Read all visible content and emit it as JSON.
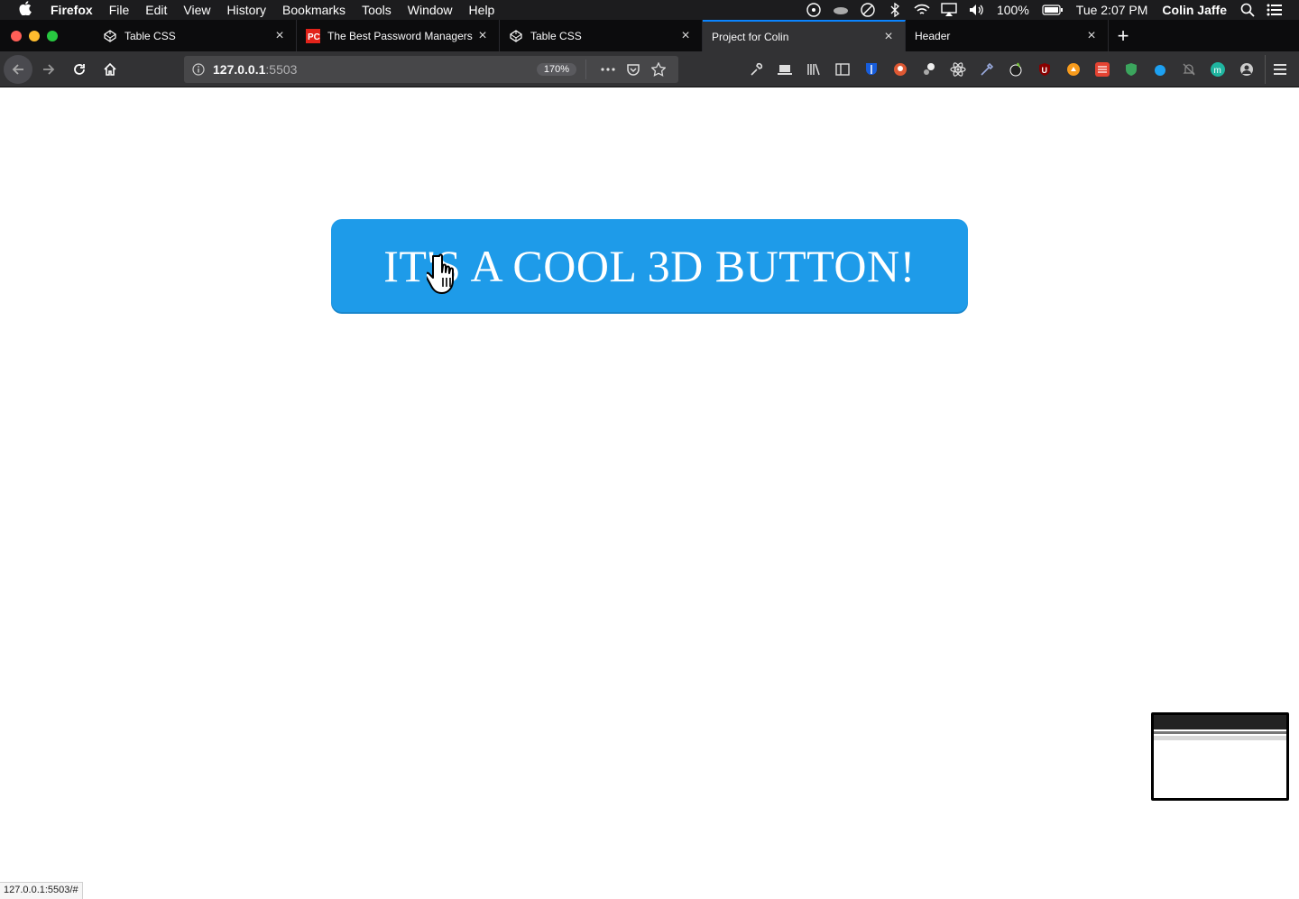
{
  "menubar": {
    "app_name": "Firefox",
    "items": [
      "File",
      "Edit",
      "View",
      "History",
      "Bookmarks",
      "Tools",
      "Window",
      "Help"
    ],
    "battery": "100%",
    "clock": "Tue 2:07 PM",
    "user": "Colin Jaffe"
  },
  "tabs": [
    {
      "title": "Table CSS",
      "icon": "codepen-icon"
    },
    {
      "title": "The Best Password Managers f",
      "icon": "pc-icon"
    },
    {
      "title": "Table CSS",
      "icon": "codepen-icon"
    },
    {
      "title": "Project for Colin",
      "icon": "none"
    },
    {
      "title": "Header",
      "icon": "none"
    }
  ],
  "navbar": {
    "url_host": "127.0.0.1",
    "url_port": ":5503",
    "zoom": "170%"
  },
  "content": {
    "button_label": "IT'S A COOL 3D BUTTON!",
    "button_color": "#1e9be9"
  },
  "statusbar": {
    "link": "127.0.0.1:5503/#"
  },
  "colors": {
    "accent": "#0a84ff",
    "close": "#ff5f57",
    "minimize": "#febc2e",
    "maximize": "#28c840"
  }
}
